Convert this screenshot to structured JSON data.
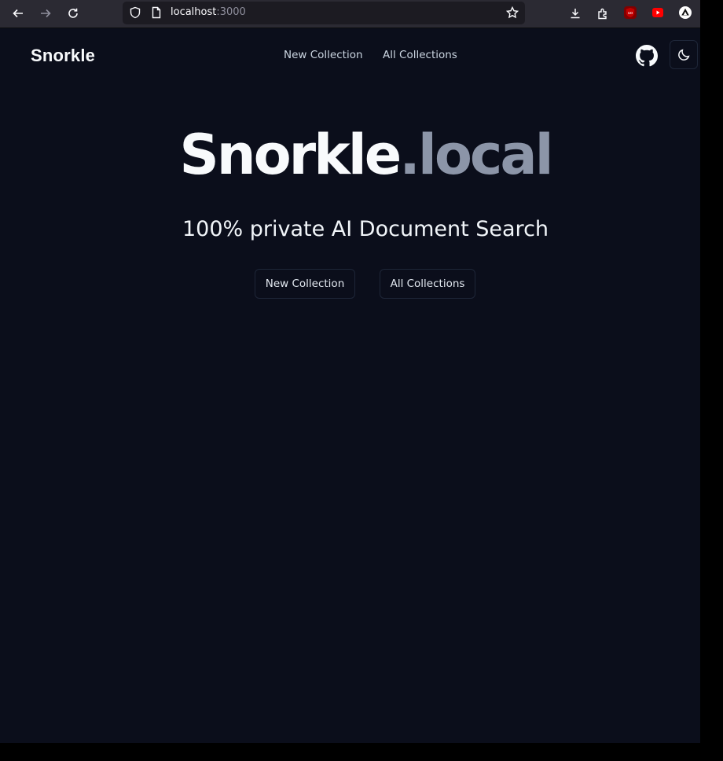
{
  "browser": {
    "url_host": "localhost",
    "url_port": ":3000",
    "icons": [
      "back-icon",
      "forward-icon",
      "reload-icon",
      "shield-icon",
      "page-icon",
      "bookmark-star-icon",
      "download-icon",
      "extensions-icon",
      "ublock-icon",
      "youtube-extension-icon",
      "account-icon"
    ]
  },
  "nav": {
    "brand": "Snorkle",
    "links": [
      "New Collection",
      "All Collections"
    ]
  },
  "hero": {
    "title_main": "Snorkle",
    "title_suffix": ".local",
    "subtitle": "100% private AI Document Search",
    "buttons": [
      "New Collection",
      "All Collections"
    ]
  },
  "colors": {
    "page_bg": "#0b0e1b",
    "title_primary": "#f8fafc",
    "title_muted": "#8c95a8",
    "browser_chrome": "#2b2a33"
  }
}
